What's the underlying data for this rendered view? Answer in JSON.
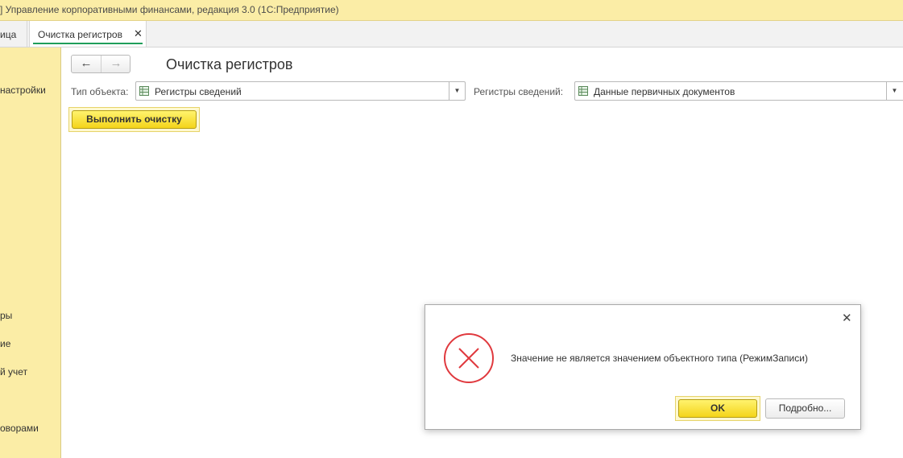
{
  "window": {
    "title": "] Управление корпоративными финансами, редакция 3.0  (1С:Предприятие)"
  },
  "tabs": {
    "home_label": "ица",
    "active_label": "Очистка регистров",
    "close_glyph": "✕"
  },
  "sidebar": {
    "items": [
      {
        "label": "настройки"
      },
      {
        "label": "ры"
      },
      {
        "label": "ие"
      },
      {
        "label": "й учет"
      },
      {
        "label": "оворами"
      }
    ]
  },
  "navigation": {
    "back_glyph": "🡐",
    "forward_glyph": "🡒"
  },
  "page": {
    "title": "Очистка регистров",
    "object_type": {
      "label": "Тип объекта:",
      "value": "Регистры сведений",
      "icon": "table-icon"
    },
    "registers": {
      "label": "Регистры сведений:",
      "value": "Данные первичных документов",
      "icon": "table-icon"
    },
    "execute_button": "Выполнить очистку"
  },
  "dialog": {
    "message": "Значение не является значением объектного типа (РежимЗаписи)",
    "ok_button": "OK",
    "details_button": "Подробно...",
    "close_glyph": "✕",
    "icon": "error-icon"
  },
  "colors": {
    "accent_yellow": "#fbeda6",
    "button_yellow": "#f4d41a",
    "error_red": "#e0393e",
    "tab_underline": "#1f9e5a"
  }
}
